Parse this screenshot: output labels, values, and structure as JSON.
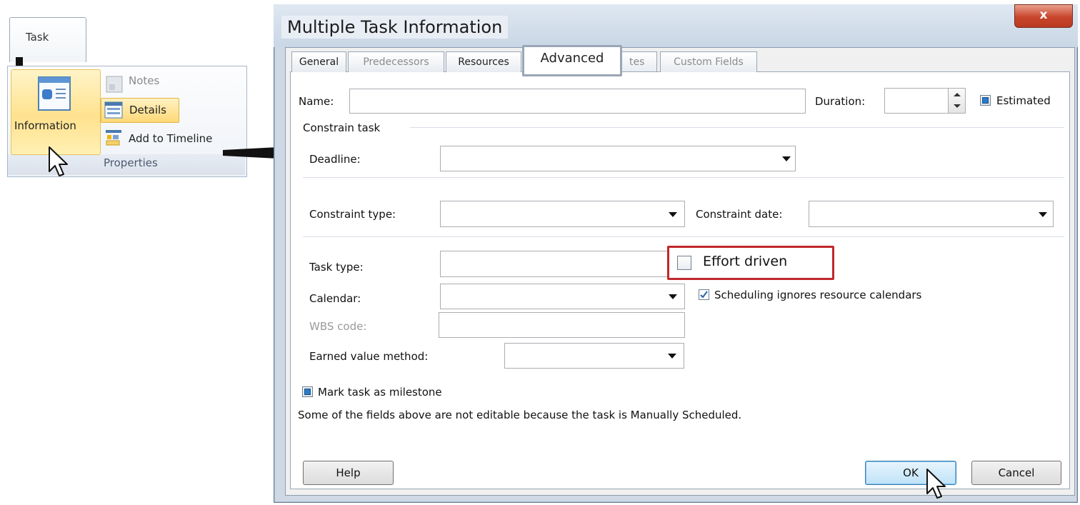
{
  "ribbon": {
    "tab_label": "Task",
    "information_label": "Information",
    "notes_label": "Notes",
    "details_label": "Details",
    "add_to_timeline_label": "Add to Timeline",
    "group_label": "Properties"
  },
  "dialog": {
    "title": "Multiple Task Information",
    "close_label": "x",
    "tabs": [
      {
        "label": "General"
      },
      {
        "label": "Predecessors"
      },
      {
        "label": "Resources"
      },
      {
        "label": "Advanced"
      },
      {
        "label": "tes"
      },
      {
        "label": "Custom Fields"
      }
    ],
    "active_tab": "Advanced",
    "name_label": "Name:",
    "name_value": "",
    "duration_label": "Duration:",
    "duration_value": "",
    "estimated_label": "Estimated",
    "estimated_checked": true,
    "constrain_task_label": "Constrain task",
    "deadline_label": "Deadline:",
    "deadline_value": "",
    "constraint_type_label": "Constraint type:",
    "constraint_type_value": "",
    "constraint_date_label": "Constraint date:",
    "constraint_date_value": "",
    "task_type_label": "Task type:",
    "task_type_value": "",
    "effort_driven_label": "Effort driven",
    "effort_driven_checked": false,
    "calendar_label": "Calendar:",
    "calendar_value": "",
    "scheduling_ignores_label": "Scheduling ignores resource calendars",
    "scheduling_ignores_checked": true,
    "wbs_code_label": "WBS code:",
    "wbs_code_value": "",
    "earned_value_label": "Earned value method:",
    "earned_value_value": "",
    "milestone_label": "Mark task as milestone",
    "milestone_checked": true,
    "note_text": "Some of the fields above are not editable because the task is Manually Scheduled.",
    "help_button": "Help",
    "ok_button": "OK",
    "cancel_button": "Cancel"
  },
  "colors": {
    "highlight": "#c0282b",
    "selected_ribbon": "#ffe28e",
    "close_button": "#c8452b",
    "checkbox_blue": "#2a7cc9"
  }
}
